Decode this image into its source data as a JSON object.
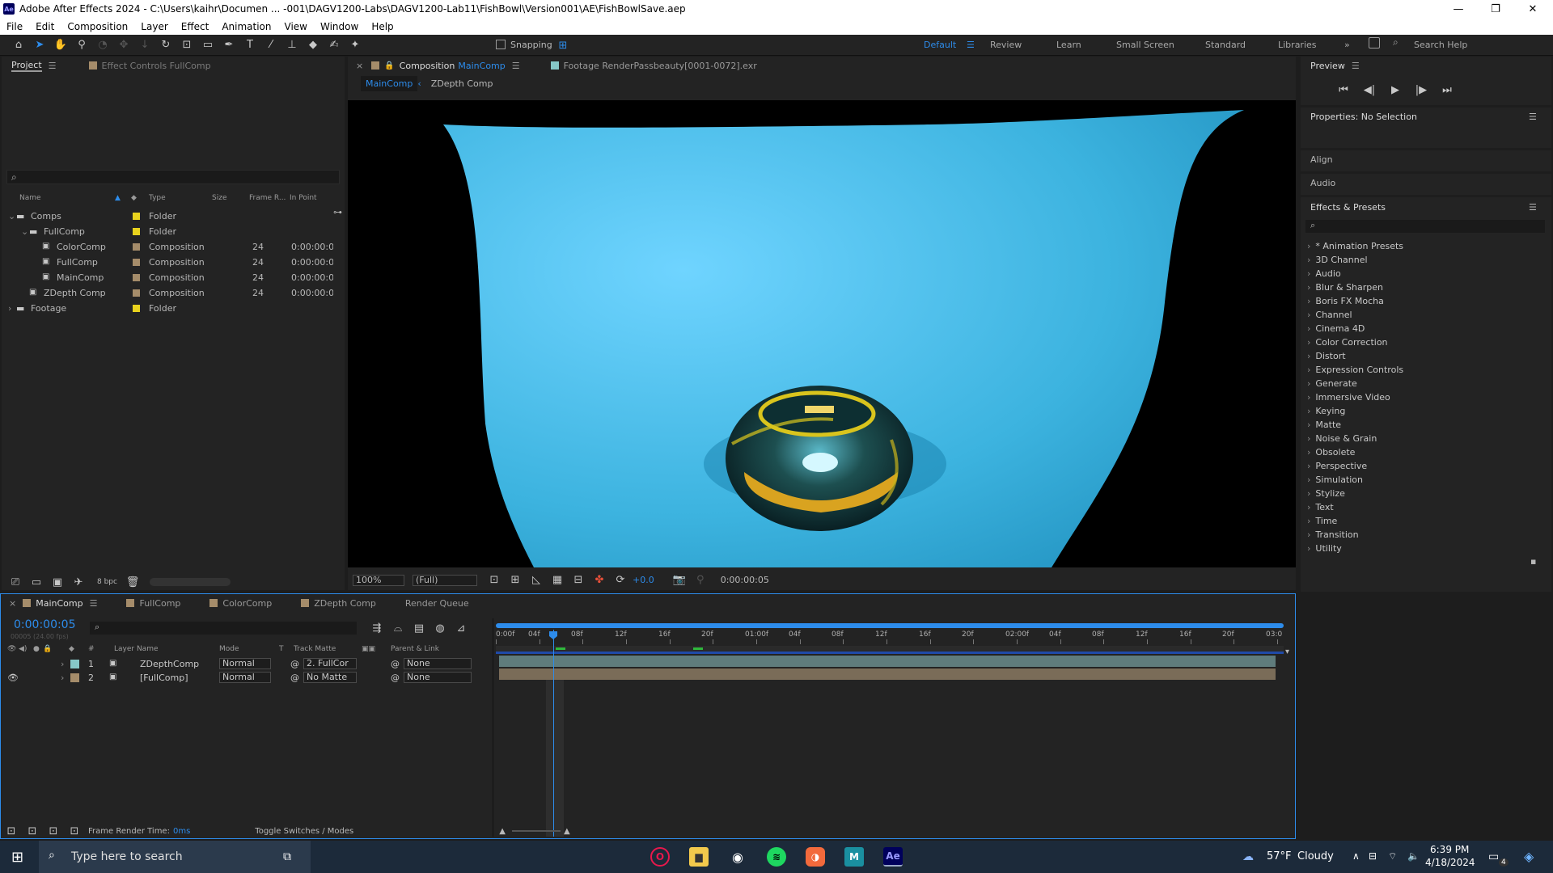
{
  "window": {
    "title": "Adobe After Effects 2024 - C:\\Users\\kaihr\\Documen ... -001\\DAGV1200-Labs\\DAGV1200-Lab11\\FishBowl\\Version001\\AE\\FishBowlSave.aep",
    "logo": "Ae",
    "minimize": "—",
    "maximize": "❐",
    "close": "✕"
  },
  "menu": [
    "File",
    "Edit",
    "Composition",
    "Layer",
    "Effect",
    "Animation",
    "View",
    "Window",
    "Help"
  ],
  "toolbar": {
    "snapping_label": "Snapping",
    "workspaces": [
      "Default",
      "Review",
      "Learn",
      "Small Screen",
      "Standard",
      "Libraries"
    ],
    "active_workspace": "Default",
    "more": "»",
    "search_placeholder": "Search Help"
  },
  "project": {
    "tab_label": "Project",
    "effect_controls_label": "Effect Controls FullComp",
    "search_icon": "⌕",
    "columns": [
      "Name",
      "Type",
      "Size",
      "Frame R...",
      "In Point"
    ],
    "rows": [
      {
        "name": "Comps",
        "type": "Folder",
        "fr": "",
        "inpoint": "",
        "indent": 0,
        "kind": "folder",
        "color": "#e8d21d",
        "open": true
      },
      {
        "name": "FullComp",
        "type": "Folder",
        "fr": "",
        "inpoint": "",
        "indent": 1,
        "kind": "folder",
        "color": "#e8d21d",
        "open": true
      },
      {
        "name": "ColorComp",
        "type": "Composition",
        "fr": "24",
        "inpoint": "0:00:00:0",
        "indent": 2,
        "kind": "comp",
        "color": "#a58c6a"
      },
      {
        "name": "FullComp",
        "type": "Composition",
        "fr": "24",
        "inpoint": "0:00:00:0",
        "indent": 2,
        "kind": "comp",
        "color": "#a58c6a"
      },
      {
        "name": "MainComp",
        "type": "Composition",
        "fr": "24",
        "inpoint": "0:00:00:0",
        "indent": 2,
        "kind": "comp",
        "color": "#a58c6a"
      },
      {
        "name": "ZDepth Comp",
        "type": "Composition",
        "fr": "24",
        "inpoint": "0:00:00:0",
        "indent": 1,
        "kind": "comp",
        "color": "#a58c6a"
      },
      {
        "name": "Footage",
        "type": "Folder",
        "fr": "",
        "inpoint": "",
        "indent": 0,
        "kind": "folder",
        "color": "#e8d21d",
        "open": false
      }
    ],
    "bpc": "8 bpc"
  },
  "composition": {
    "tab_prefix": "Composition",
    "tab_name": "MainComp",
    "footage_tab": "Footage  RenderPassbeauty[0001-0072].exr",
    "breadcrumb": [
      "MainComp",
      "ZDepth Comp"
    ],
    "zoom": "100%",
    "resolution": "(Full)",
    "exposure": "+0.0",
    "timecode": "0:00:00:05"
  },
  "preview": {
    "title": "Preview",
    "controls": [
      "⏮",
      "◀|",
      "▶",
      "|▶",
      "⏭"
    ]
  },
  "properties": {
    "title": "Properties: No Selection"
  },
  "align": {
    "title": "Align"
  },
  "audio": {
    "title": "Audio"
  },
  "effects": {
    "title": "Effects & Presets",
    "items": [
      "* Animation Presets",
      "3D Channel",
      "Audio",
      "Blur & Sharpen",
      "Boris FX Mocha",
      "Channel",
      "Cinema 4D",
      "Color Correction",
      "Distort",
      "Expression Controls",
      "Generate",
      "Immersive Video",
      "Keying",
      "Matte",
      "Noise & Grain",
      "Obsolete",
      "Perspective",
      "Simulation",
      "Stylize",
      "Text",
      "Time",
      "Transition",
      "Utility"
    ]
  },
  "timeline": {
    "tabs": [
      {
        "name": "MainComp",
        "color": "#a58c6a"
      },
      {
        "name": "FullComp",
        "color": "#a58c6a"
      },
      {
        "name": "ColorComp",
        "color": "#a58c6a"
      },
      {
        "name": "ZDepth Comp",
        "color": "#a58c6a"
      },
      {
        "name": "Render Queue",
        "color": ""
      }
    ],
    "current_time": "0:00:00:05",
    "fps_info": "00005 (24.00 fps)",
    "columns": {
      "num": "#",
      "layer_name": "Layer Name",
      "mode": "Mode",
      "t": "T",
      "track_matte": "Track Matte",
      "parent": "Parent & Link"
    },
    "layers": [
      {
        "num": "1",
        "name": "ZDepthComp",
        "mode": "Normal",
        "matte": "2. FullCor",
        "parent": "None",
        "color": "#86c7c7",
        "visible": false
      },
      {
        "num": "2",
        "name": "[FullComp]",
        "mode": "Normal",
        "matte": "No Matte",
        "parent": "None",
        "color": "#a58c6a",
        "visible": true
      }
    ],
    "ruler": [
      "0:00f",
      "04f",
      "08f",
      "12f",
      "16f",
      "20f",
      "01:00f",
      "04f",
      "08f",
      "12f",
      "16f",
      "20f",
      "02:00f",
      "04f",
      "08f",
      "12f",
      "16f",
      "20f",
      "03:0"
    ],
    "render_time_label": "Frame Render Time:",
    "render_time": "0ms",
    "toggle_label": "Toggle Switches / Modes"
  },
  "taskbar": {
    "search_text": "Type here to search",
    "weather_temp": "57°F",
    "weather_cond": "Cloudy",
    "time": "6:39 PM",
    "date": "4/18/2024",
    "notif_count": "4"
  }
}
